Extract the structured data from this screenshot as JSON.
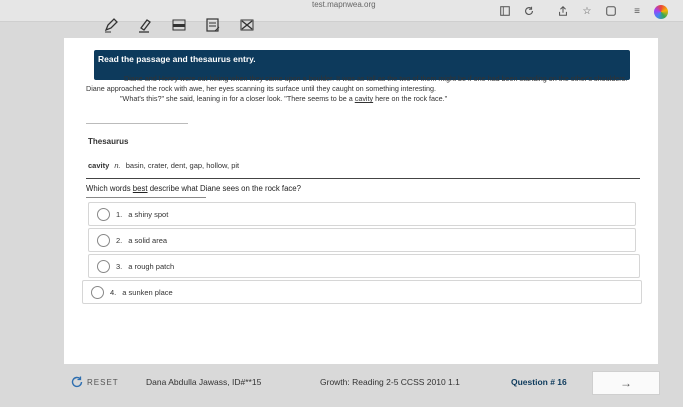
{
  "browser": {
    "url": "test.mapnwea.org"
  },
  "header": {
    "instruction": "Read the passage and thesaurus entry."
  },
  "passage": {
    "p1": "Diane and Henry were out hiking when they came upon a boulder. It was as tall as the two of them might be if one had been standing on the other's shoulders. Diane approached the rock with awe, her eyes scanning its surface until they caught on something interesting.",
    "p2_before": "\"What's this?\" she said, leaning in for a closer look. \"There seems to be a ",
    "p2_word": "cavity",
    "p2_after": " here on the rock face.\""
  },
  "thesaurus": {
    "title": "Thesaurus",
    "word": "cavity",
    "pos": "n.",
    "synonyms": "basin, crater, dent, gap, hollow, pit"
  },
  "question": {
    "before": "Which words ",
    "emph": "best",
    "after": " describe what Diane sees on the rock face?"
  },
  "options": [
    {
      "num": "1.",
      "text": "a shiny spot"
    },
    {
      "num": "2.",
      "text": "a solid area"
    },
    {
      "num": "3.",
      "text": "a rough patch"
    },
    {
      "num": "4.",
      "text": "a sunken place"
    }
  ],
  "footer": {
    "reset_label": "RESET",
    "student": "Dana Abdulla Jawass, ID#**15",
    "growth": "Growth: Reading 2-5 CCSS 2010 1.1",
    "question_number": "Question # 16",
    "next_arrow": "→"
  },
  "colors": {
    "header": "#0d3a5c",
    "background": "#d9d9d9"
  }
}
